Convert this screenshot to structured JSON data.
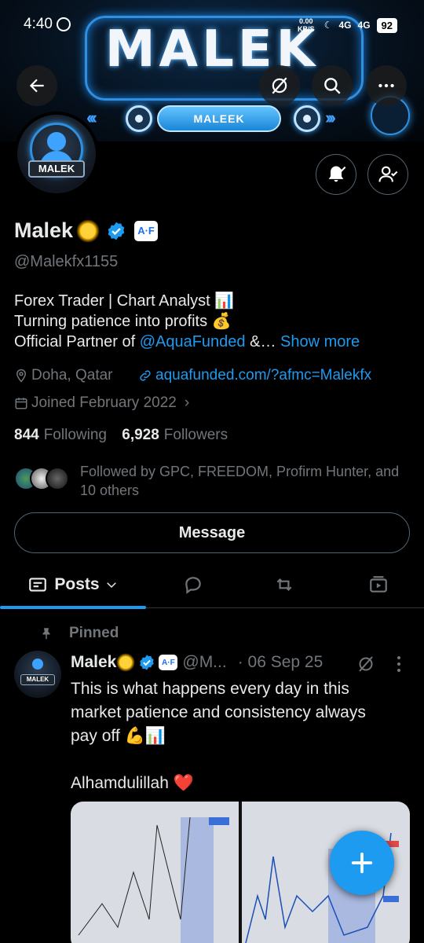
{
  "status_bar": {
    "time": "4:40",
    "speed": "0.00 KB/S",
    "network1": "4G",
    "network2": "4G",
    "battery": "92"
  },
  "banner": {
    "title": "MALEK",
    "pill_text": "MALEEK"
  },
  "avatar": {
    "plate_text": "MALEK"
  },
  "profile": {
    "name": "Malek",
    "af_badge": "A·F",
    "handle": "@Malekfx1155",
    "bio": {
      "line1": "Forex Trader | Chart Analyst 📊",
      "line2": "Turning patience into profits 💰",
      "line3_prefix": "Official Partner of ",
      "line3_mention": "@AquaFunded",
      "line3_suffix": " &… ",
      "show_more": "Show more"
    },
    "location": "Doha, Qatar",
    "website": "aquafunded.com/?afmc=Malekfx",
    "joined": "Joined February 2022",
    "following_count": "844",
    "following_label": "Following",
    "followers_count": "6,928",
    "followers_label": "Followers",
    "followed_by": "Followed by GPC, FREEDOM, Profirm Hunter, and 10 others"
  },
  "actions": {
    "message": "Message"
  },
  "tabs": {
    "posts_label": "Posts"
  },
  "pinned_post": {
    "pinned_label": "Pinned",
    "author": "Malek",
    "af_badge": "A·F",
    "handle": "@M...",
    "date": "· 06 Sep 25",
    "text_line1": "This is what happens every day in this",
    "text_line2": "market patience and consistency always",
    "text_line3": "pay off 💪📊",
    "text_line4": "Alhamdulillah ❤️"
  },
  "colors": {
    "accent": "#1d9bf0",
    "muted": "#71767b",
    "text": "#e7e9ea",
    "background": "#000000"
  }
}
